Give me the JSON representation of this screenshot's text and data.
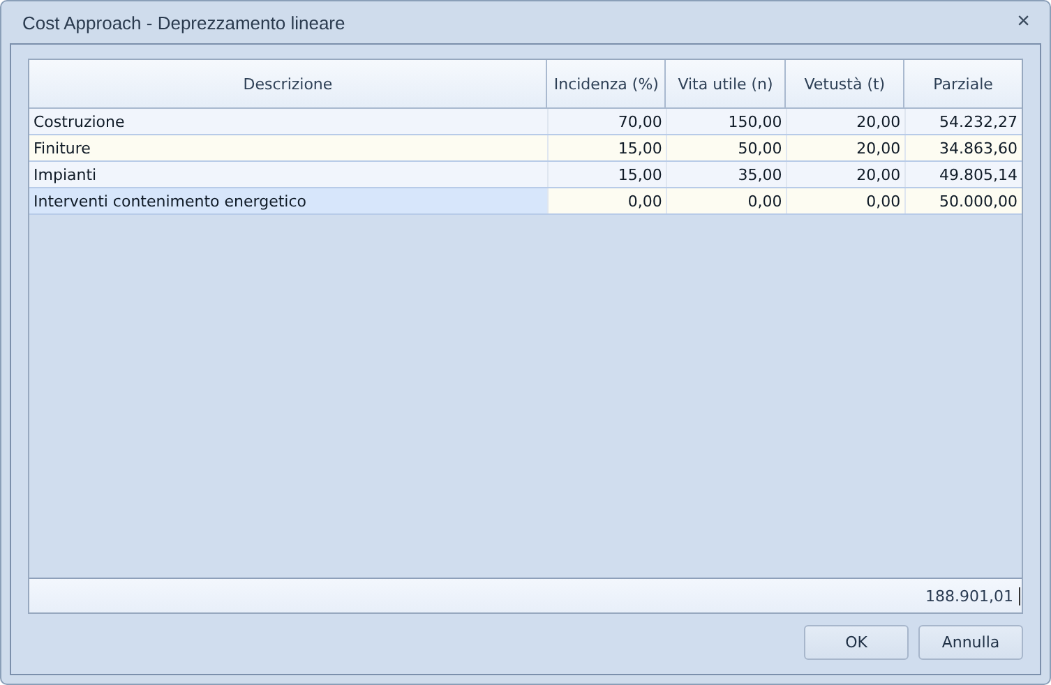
{
  "window": {
    "title": "Cost Approach - Deprezzamento lineare",
    "close": "×"
  },
  "table": {
    "columns": [
      "Descrizione",
      "Incidenza (%)",
      "Vita utile (n)",
      "Vetustà (t)",
      "Parziale"
    ],
    "rows": [
      {
        "cells": [
          "Costruzione",
          "70,00",
          "150,00",
          "20,00",
          "54.232,27"
        ],
        "selected": false
      },
      {
        "cells": [
          "Finiture",
          "15,00",
          "50,00",
          "20,00",
          "34.863,60"
        ],
        "selected": false
      },
      {
        "cells": [
          "Impianti",
          "15,00",
          "35,00",
          "20,00",
          "49.805,14"
        ],
        "selected": false
      },
      {
        "cells": [
          "Interventi contenimento energetico",
          "0,00",
          "0,00",
          "0,00",
          "50.000,00"
        ],
        "selected": true
      }
    ],
    "total": "188.901,01"
  },
  "buttons": [
    "OK",
    "Annulla"
  ]
}
